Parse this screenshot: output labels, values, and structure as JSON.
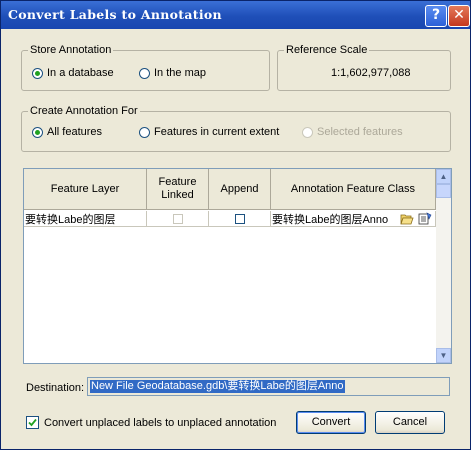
{
  "window": {
    "title": "Convert Labels to Annotation",
    "help_symbol": "?",
    "close_symbol": "✕"
  },
  "store_annotation": {
    "label": "Store Annotation",
    "options": [
      {
        "label": "In a database",
        "selected": true
      },
      {
        "label": "In the map",
        "selected": false
      }
    ]
  },
  "reference_scale": {
    "label": "Reference Scale",
    "value": "1:1,602,977,088"
  },
  "create_for": {
    "label": "Create Annotation For",
    "options": [
      {
        "label": "All features",
        "selected": true,
        "enabled": true
      },
      {
        "label": "Features in current extent",
        "selected": false,
        "enabled": true
      },
      {
        "label": "Selected features",
        "selected": false,
        "enabled": false
      }
    ]
  },
  "table": {
    "columns": [
      "Feature Layer",
      "Feature Linked",
      "Append",
      "Annotation Feature Class"
    ],
    "rows": [
      {
        "feature_layer": "要转换Labe的图层",
        "feature_linked": false,
        "append": false,
        "annotation_class": "要转换Labe的图层Anno"
      }
    ]
  },
  "destination": {
    "label": "Destination:",
    "value": "New File Geodatabase.gdb\\要转换Labe的图层Anno"
  },
  "convert_unplaced": {
    "label": "Convert unplaced labels to unplaced annotation",
    "checked": true
  },
  "buttons": {
    "convert": "Convert",
    "cancel": "Cancel"
  }
}
